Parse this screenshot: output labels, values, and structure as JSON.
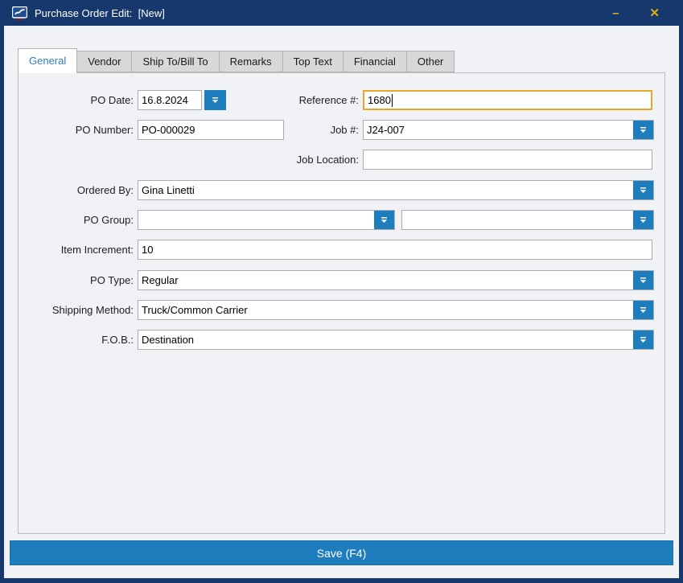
{
  "window": {
    "title": "Purchase Order Edit:  [New]",
    "minimize_glyph": "–",
    "close_glyph": "✕"
  },
  "tabs": [
    {
      "label": "General",
      "active": true
    },
    {
      "label": "Vendor",
      "active": false
    },
    {
      "label": "Ship To/Bill To",
      "active": false
    },
    {
      "label": "Remarks",
      "active": false
    },
    {
      "label": "Top Text",
      "active": false
    },
    {
      "label": "Financial",
      "active": false
    },
    {
      "label": "Other",
      "active": false
    }
  ],
  "form": {
    "po_date": {
      "label": "PO Date:",
      "value": "16.8.2024"
    },
    "reference": {
      "label": "Reference #:",
      "value": "1680"
    },
    "po_number": {
      "label": "PO Number:",
      "value": "PO-000029"
    },
    "job_number": {
      "label": "Job #:",
      "value": "J24-007"
    },
    "job_location": {
      "label": "Job Location:",
      "value": ""
    },
    "ordered_by": {
      "label": "Ordered By:",
      "value": "Gina Linetti"
    },
    "po_group": {
      "label": "PO Group:",
      "value_primary": "",
      "value_secondary": ""
    },
    "item_increment": {
      "label": "Item Increment:",
      "value": "10"
    },
    "po_type": {
      "label": "PO Type:",
      "value": "Regular"
    },
    "shipping_method": {
      "label": "Shipping Method:",
      "value": "Truck/Common Carrier"
    },
    "fob": {
      "label": "F.O.B.:",
      "value": "Destination"
    }
  },
  "save_button": {
    "label": "Save (F4)"
  },
  "colors": {
    "titlebar": "#16386c",
    "accent_blue": "#1e7dbd",
    "focus_border": "#e9a823",
    "active_tab_text": "#2e7cc3",
    "titlebar_controls": "#e2ae15"
  }
}
